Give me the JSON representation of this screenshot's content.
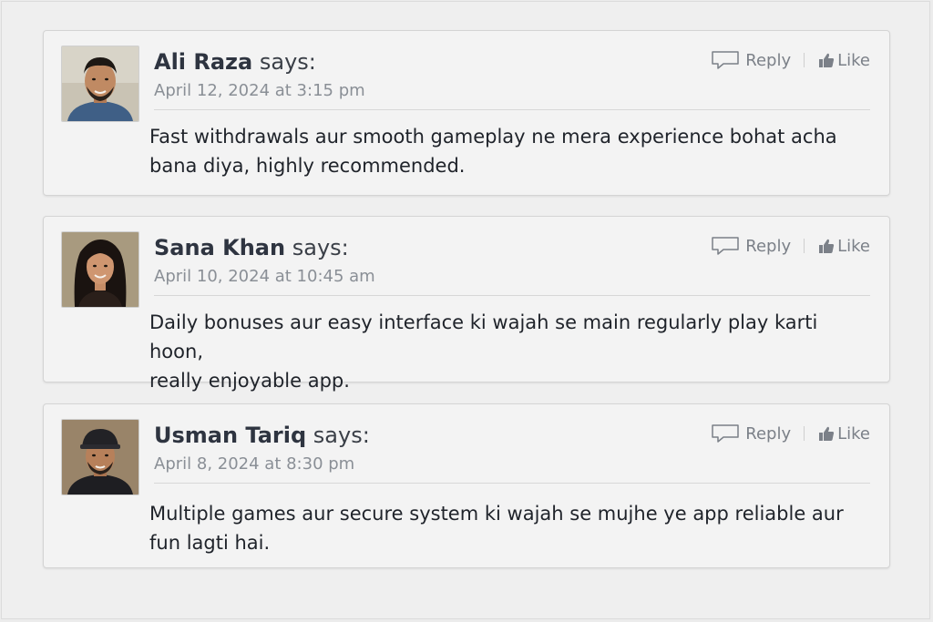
{
  "comments": [
    {
      "author": "Ali Raza",
      "says": "says:",
      "date": "April 12, 2024 at 3:15 pm",
      "text": "Fast withdrawals aur smooth gameplay ne mera experience bohat acha bana diya, highly recommended.",
      "reply_label": "Reply",
      "like_label": "Like"
    },
    {
      "author": "Sana Khan",
      "says": "says:",
      "date": "April 10, 2024 at 10:45 am",
      "text_line1": "Daily bonuses aur easy interface ki wajah se main regularly play karti hoon,",
      "text_line2": "really enjoyable app.",
      "reply_label": "Reply",
      "like_label": "Like"
    },
    {
      "author": "Usman Tariq",
      "says": "says:",
      "date": "April 8, 2024 at 8:30 pm",
      "text": "Multiple games aur secure system ki wajah se mujhe ye app reliable aur fun lagti hai.",
      "reply_label": "Reply",
      "like_label": "Like"
    }
  ],
  "colors": {
    "author": "#2e3440",
    "date": "#8a8f96",
    "body": "#1f232a",
    "action": "#7b8088"
  }
}
